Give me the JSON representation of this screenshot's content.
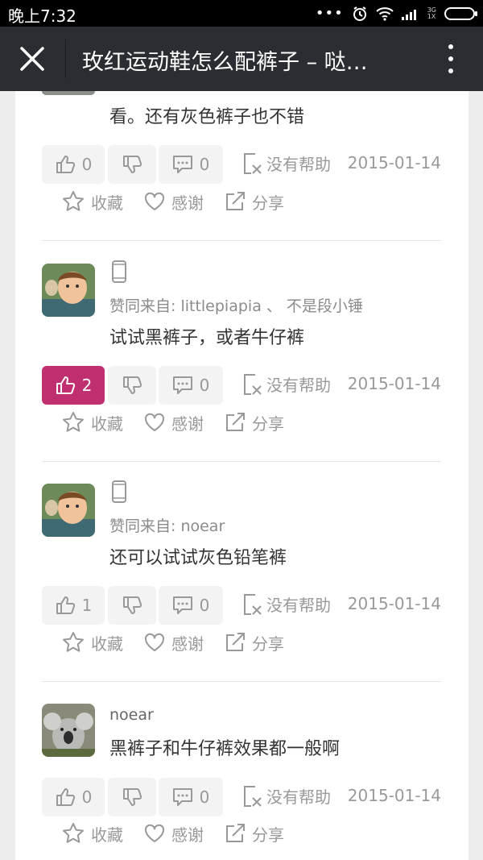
{
  "statusbar": {
    "time": "晚上7:32",
    "network": [
      "3G",
      "1X"
    ]
  },
  "titlebar": {
    "title": "玫红运动鞋怎么配裤子 – 哒…"
  },
  "posts": [
    {
      "text": "看。还有灰色裤子也不错",
      "likes": "0",
      "comments": "0",
      "liked": false
    },
    {
      "agreed": "赞同来自: littlepiapia 、  不是段小锤",
      "text": "试试黑裤子，或者牛仔裤",
      "likes": "2",
      "comments": "0",
      "liked": true
    },
    {
      "agreed": "赞同来自: noear",
      "text": "还可以试试灰色铅笔裤",
      "likes": "1",
      "comments": "0",
      "liked": false
    },
    {
      "username": "noear",
      "text": "黑裤子和牛仔裤效果都一般啊",
      "likes": "0",
      "comments": "0",
      "liked": false
    }
  ],
  "labels": {
    "no_help": "没有帮助",
    "date": "2015-01-14",
    "favorite": "收藏",
    "thanks": "感谢",
    "share": "分享"
  },
  "colors": {
    "like_active": "#c03070",
    "titlebar": "#2a2d31",
    "statusbar": "#000000"
  },
  "icons": [
    "close-icon",
    "more-vert-icon",
    "thumbs-up-icon",
    "thumbs-down-icon",
    "comment-icon",
    "no-help-icon",
    "star-icon",
    "heart-icon",
    "share-icon",
    "phone-icon"
  ]
}
